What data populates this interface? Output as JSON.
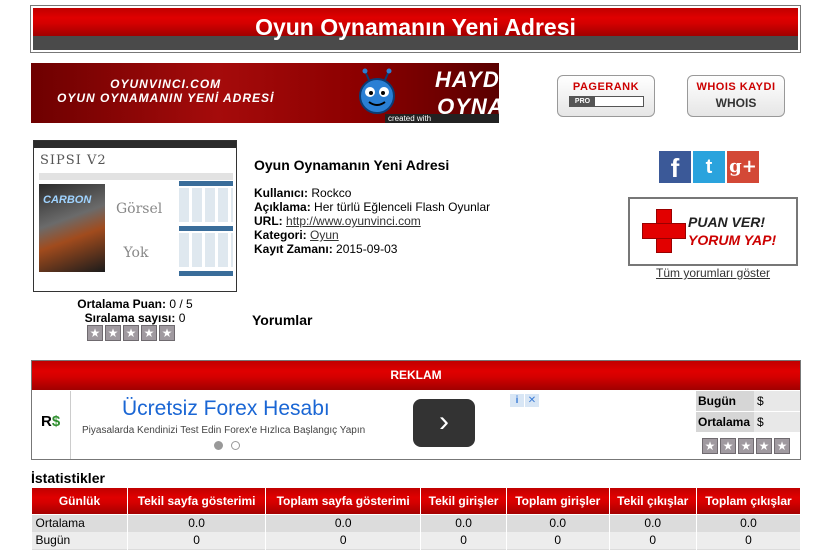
{
  "header": {
    "title": "Oyun Oynamanın Yeni Adresi"
  },
  "banner": {
    "line1": "OYUNVINCI.COM",
    "line2": "OYUN OYNAMANIN YENİ ADRESİ",
    "cta1": "HAYDI",
    "cta2": "OYNA",
    "credit": "created with BannerSnack.com"
  },
  "badges": {
    "pagerank": {
      "line1": "PAGERANK",
      "pro": "PRO"
    },
    "whois": {
      "line1": "WHOIS KAYDI",
      "line2": "WHOIS"
    }
  },
  "thumbnail": {
    "logo": "SIPSI V2",
    "game_title": "CARBON",
    "placeholder": "Görsel Yok"
  },
  "rating": {
    "avg_label": "Ortalama Puan:",
    "avg_value": "0 / 5",
    "count_label": "Sıralama sayısı:",
    "count_value": "0",
    "star_glyph": "★"
  },
  "info": {
    "title": "Oyun Oynamanın Yeni Adresi",
    "user_label": "Kullanıcı:",
    "user_value": "Rockco",
    "desc_label": "Açıklama:",
    "desc_value": "Her türlü Eğlenceli Flash Oyunlar",
    "url_label": "URL:",
    "url_value": "http://www.oyunvinci.com",
    "category_label": "Kategori:",
    "category_value": "Oyun",
    "date_label": "Kayıt Zamanı:",
    "date_value": "2015-09-03"
  },
  "comments_heading": "Yorumlar",
  "social": {
    "fb": "f",
    "tw": "t",
    "gp": "g+"
  },
  "puan_box": {
    "line1": "PUAN VER!",
    "line2": "YORUM YAP!"
  },
  "all_comments_link": "Tüm yorumları göster",
  "reklam": {
    "title": "REKLAM",
    "ad_logo_r": "R",
    "ad_logo_dollar": "$",
    "ad_title": "Ücretsiz Forex Hesabı",
    "ad_desc": "Piyasalarda Kendinizi Test Edin Forex'e Hızlıca Başlangıç Yapın",
    "ad_arrow": "›",
    "ad_choices_i": "i",
    "ad_choices_x": "✕"
  },
  "mini_stats": {
    "today_label": "Bugün",
    "today_value": "$",
    "avg_label": "Ortalama",
    "avg_value": "$"
  },
  "statistics": {
    "title": "İstatistikler",
    "headers": [
      "Günlük",
      "Tekil sayfa gösterimi",
      "Toplam sayfa gösterimi",
      "Tekil girişler",
      "Toplam girişler",
      "Tekil çıkışlar",
      "Toplam çıkışlar"
    ],
    "rows": [
      [
        "Ortalama",
        "0.0",
        "0.0",
        "0.0",
        "0.0",
        "0.0",
        "0.0"
      ],
      [
        "Bugün",
        "0",
        "0",
        "0",
        "0",
        "0",
        "0"
      ],
      [
        "",
        "",
        "",
        "",
        "",
        "",
        ""
      ]
    ]
  },
  "colors": {
    "primary_red": "#d40000",
    "header_dark": "#4a4a4a",
    "link": "#333333",
    "ad_blue": "#1a66d4"
  }
}
